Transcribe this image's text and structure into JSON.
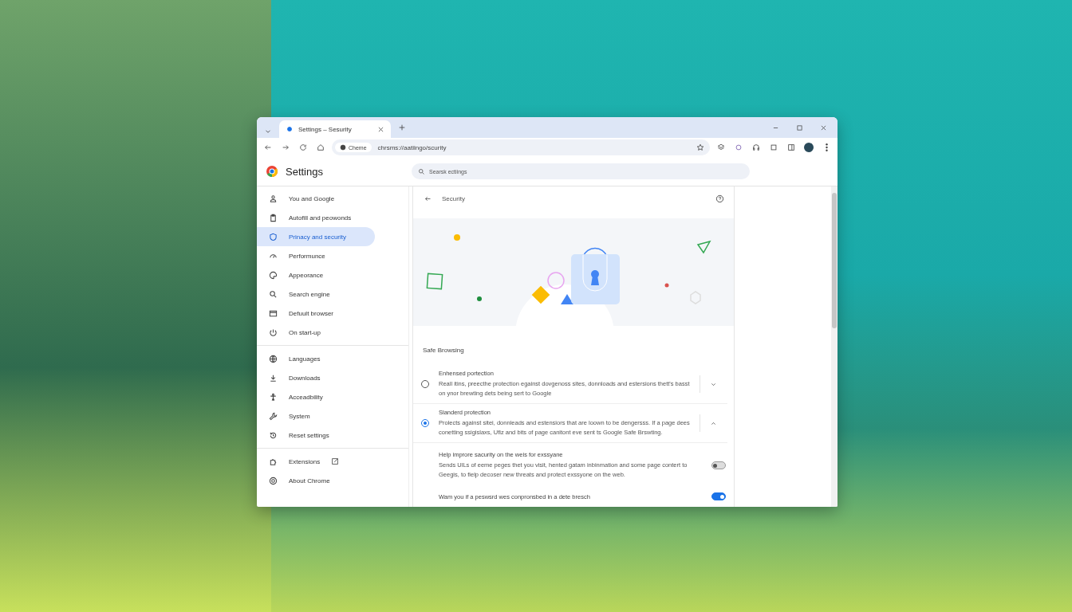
{
  "tab": {
    "title": "Settings – Sesurity"
  },
  "address": {
    "chip": "Cheme",
    "url": "chrsms://aatiingo/scurity"
  },
  "header": {
    "title": "Settings",
    "search_placeholder": "Searsk ectiings"
  },
  "sidebar": {
    "groups": [
      {
        "items": [
          {
            "label": "You and Google",
            "selected": false
          },
          {
            "label": "Autofill and peowonds",
            "selected": false
          },
          {
            "label": "Prinacy and security",
            "selected": true
          },
          {
            "label": "Performunce",
            "selected": false
          },
          {
            "label": "Appeorance",
            "selected": false
          },
          {
            "label": "Search engine",
            "selected": false
          },
          {
            "label": "Defuult browser",
            "selected": false
          },
          {
            "label": "On start-up",
            "selected": false
          }
        ]
      },
      {
        "items": [
          {
            "label": "Languages",
            "selected": false
          },
          {
            "label": "Downloads",
            "selected": false
          },
          {
            "label": "Acceadbility",
            "selected": false
          },
          {
            "label": "System",
            "selected": false
          },
          {
            "label": "Reset settings",
            "selected": false
          }
        ]
      },
      {
        "items": [
          {
            "label": "Extensions",
            "selected": false
          },
          {
            "label": "About Chrome",
            "selected": false
          }
        ]
      }
    ]
  },
  "page": {
    "title": "Security",
    "section": "Safe Browsing",
    "options": [
      {
        "title": "Enhensed portection",
        "description": "Reall itins, preecthe protection egainst dovgenoss sites, donnloads and estersions thett's basst on ynor brewting dets being sert to Google",
        "selected": false,
        "expanded": false
      },
      {
        "title": "Slanderd protection",
        "description": "Prolects against sitei, donnleads and estensiors that are loown to be dengersss. If a page dees conetting ssigislaxs, Ufiz and bits of page canitont eve sent ts Google Safe Brswting.",
        "selected": true,
        "expanded": true
      }
    ],
    "settings": [
      {
        "title": "Help improre sacurity on the weis for exssyane",
        "description": "Sends UlLs of eeme peges thet you visit, hented gatam inbinmation and some page contert to Geegis, to fielp decoser new threats and protect exssyone on the web.",
        "on": false
      },
      {
        "title": "Wam you if a peswsrd wes conpronsbed in a dete bresch",
        "on": true
      }
    ]
  }
}
